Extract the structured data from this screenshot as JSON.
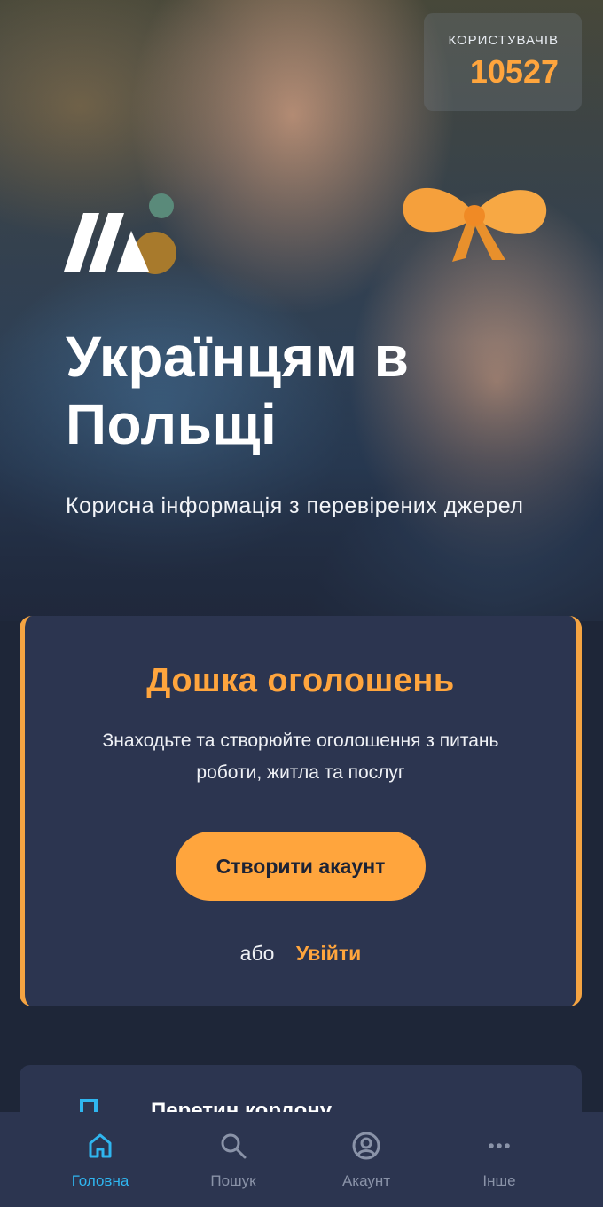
{
  "stats": {
    "users_label": "КОРИСТУВАЧІВ",
    "users_count": "10527"
  },
  "hero": {
    "title": "Українцям в Польщі",
    "subtitle": "Корисна інформація з перевірених джерел"
  },
  "board": {
    "title": "Дошка оголошень",
    "description": "Знаходьте та створюйте оголошення з питань роботи, житла та послуг",
    "create_button": "Створити акаунт",
    "or_text": "або",
    "login_link": "Увійти"
  },
  "next_section": {
    "title": "Перетин кордону",
    "icon": "border-crossing-icon"
  },
  "nav": {
    "items": [
      {
        "label": "Головна",
        "icon": "home-icon",
        "active": true
      },
      {
        "label": "Пошук",
        "icon": "search-icon",
        "active": false
      },
      {
        "label": "Акаунт",
        "icon": "account-icon",
        "active": false
      },
      {
        "label": "Інше",
        "icon": "more-icon",
        "active": false
      }
    ]
  },
  "colors": {
    "accent": "#ffa53d",
    "background": "#1e2638",
    "card": "#2c3550",
    "nav_active": "#2fb6f0",
    "nav_inactive": "#8a93a8"
  }
}
